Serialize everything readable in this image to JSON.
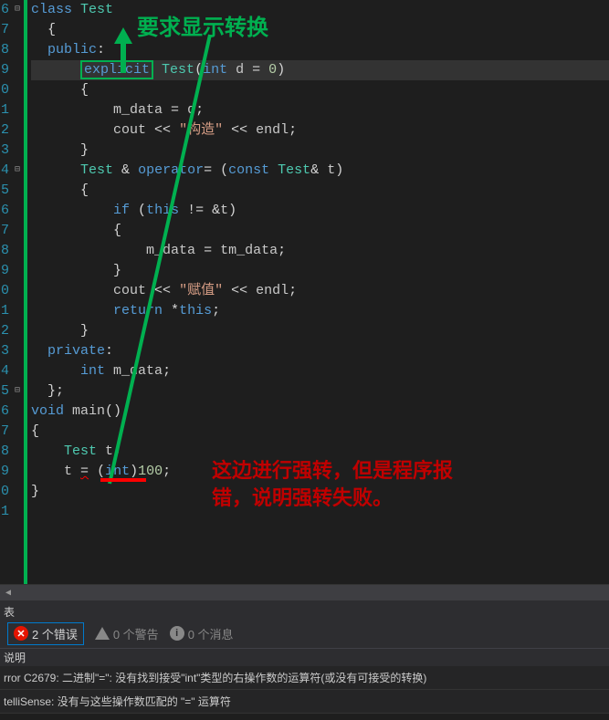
{
  "line_numbers": [
    "6",
    "7",
    "8",
    "9",
    "0",
    "1",
    "2",
    "3",
    "4",
    "5",
    "6",
    "7",
    "8",
    "9",
    "0",
    "1",
    "2",
    "3",
    "4",
    "5",
    "6",
    "7",
    "8",
    "9",
    "0",
    "1"
  ],
  "fold_markers": {
    "0": "⊟",
    "8": "⊟",
    "19": "⊟"
  },
  "code": {
    "l0": {
      "kw": "class",
      "cls": "Test"
    },
    "l1": {
      "br": "{"
    },
    "l2": {
      "kw": "public",
      "colon": ":"
    },
    "l3": {
      "kw": "explicit",
      "cls": "Test",
      "type": "int",
      "var": "d",
      "eq": "=",
      "num": "0"
    },
    "l4": {
      "br": "{"
    },
    "l5": {
      "var": "m_data",
      "eq": "=",
      "rhs": "d",
      ";": ";"
    },
    "l6": {
      "obj": "cout",
      "op": "<<",
      "str": "\"构造\"",
      "op2": "<<",
      "endl": "endl",
      ";": ";"
    },
    "l7": {
      "br": "}"
    },
    "l8": {
      "cls": "Test",
      "amp": "&",
      "kw": "operator",
      "eq": "=",
      "paren": "(",
      "const": "const",
      "cls2": "Test",
      "amp2": "&",
      "var": "t",
      "paren2": ")"
    },
    "l9": {
      "br": "{"
    },
    "l10": {
      "kw": "if",
      "paren": "(",
      "this": "this",
      "op": "!=",
      "amp": "&",
      "var": "t",
      "paren2": ")"
    },
    "l11": {
      "br": "{"
    },
    "l12": {
      "var": "m_data",
      "eq": "=",
      "obj": "t",
      ".": ".",
      "mem": "m_data",
      ";": ";"
    },
    "l13": {
      "br": "}"
    },
    "l14": {
      "obj": "cout",
      "op": "<<",
      "str": "\"赋值\"",
      "op2": "<<",
      "endl": "endl",
      ";": ";"
    },
    "l15": {
      "kw": "return",
      "star": "*",
      "this": "this",
      ";": ";"
    },
    "l16": {
      "br": "}"
    },
    "l17": {
      "kw": "private",
      "colon": ":"
    },
    "l18": {
      "type": "int",
      "var": "m_data",
      ";": ";"
    },
    "l19": {
      "br": "};"
    },
    "l20": {
      "type": "void",
      "fn": "main",
      "paren": "()"
    },
    "l21": {
      "br": "{"
    },
    "l22": {
      "cls": "Test",
      "var": "t",
      ";": ";"
    },
    "l23": {
      "var": "t",
      "eq": "=",
      "paren": "(",
      "type": "int",
      "paren2": ")",
      "num": "100",
      ";": ";"
    },
    "l24": {
      "br": "}"
    }
  },
  "annotations": {
    "green_label": "要求显示转换",
    "red_line1": "这边进行强转，但是程序报",
    "red_line2": "错，说明强转失败。"
  },
  "tab_label": "表",
  "errors": {
    "error_count_label": "2 个错误",
    "warn_count_label": "0 个警告",
    "info_count_label": "0 个消息",
    "desc_header": "说明",
    "rows": [
      "rror C2679: 二进制\"=\": 没有找到接受\"int\"类型的右操作数的运算符(或没有可接受的转换)",
      "telliSense:  没有与这些操作数匹配的 \"=\" 运算符"
    ]
  }
}
